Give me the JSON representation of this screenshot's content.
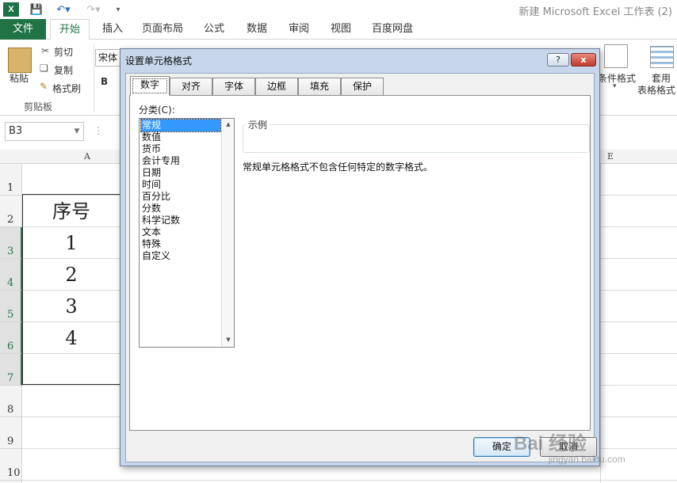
{
  "window": {
    "title": "新建 Microsoft Excel 工作表 (2)",
    "logo_text": "X"
  },
  "ribbon": {
    "tabs": [
      "文件",
      "开始",
      "插入",
      "页面布局",
      "公式",
      "数据",
      "审阅",
      "视图",
      "百度网盘"
    ],
    "clipboard": {
      "paste": "粘贴",
      "cut": "剪切",
      "copy": "复制",
      "format_painter": "格式刷",
      "group": "剪贴板"
    },
    "font_name": "宋体",
    "bold": "B",
    "conditional_format": "条件格式",
    "table_format_1": "套用",
    "table_format_2": "表格格式"
  },
  "formula_bar": {
    "name_box": "B3"
  },
  "sheet": {
    "columns": [
      "A",
      "E"
    ],
    "rows": [
      "1",
      "2",
      "3",
      "4",
      "5",
      "6",
      "7",
      "8",
      "9",
      "10"
    ],
    "selected_rows": [
      "3",
      "4",
      "5",
      "6",
      "7"
    ],
    "cells": [
      "序号",
      "1",
      "2",
      "3",
      "4"
    ]
  },
  "dialog": {
    "title": "设置单元格格式",
    "help": "?",
    "close": "x",
    "tabs": [
      "数字",
      "对齐",
      "字体",
      "边框",
      "填充",
      "保护"
    ],
    "active_tab": "数字",
    "category_label": "分类(C):",
    "categories": [
      "常规",
      "数值",
      "货币",
      "会计专用",
      "日期",
      "时间",
      "百分比",
      "分数",
      "科学记数",
      "文本",
      "特殊",
      "自定义"
    ],
    "selected_category": "常规",
    "sample_label": "示例",
    "description": "常规单元格格式不包含任何特定的数字格式。",
    "ok": "确定",
    "cancel": "取消"
  },
  "watermark": {
    "text": "Bai 经验",
    "url": "jingyan.baidu.com"
  },
  "colors": {
    "excel_green": "#217346",
    "selection_blue": "#3399ff"
  }
}
